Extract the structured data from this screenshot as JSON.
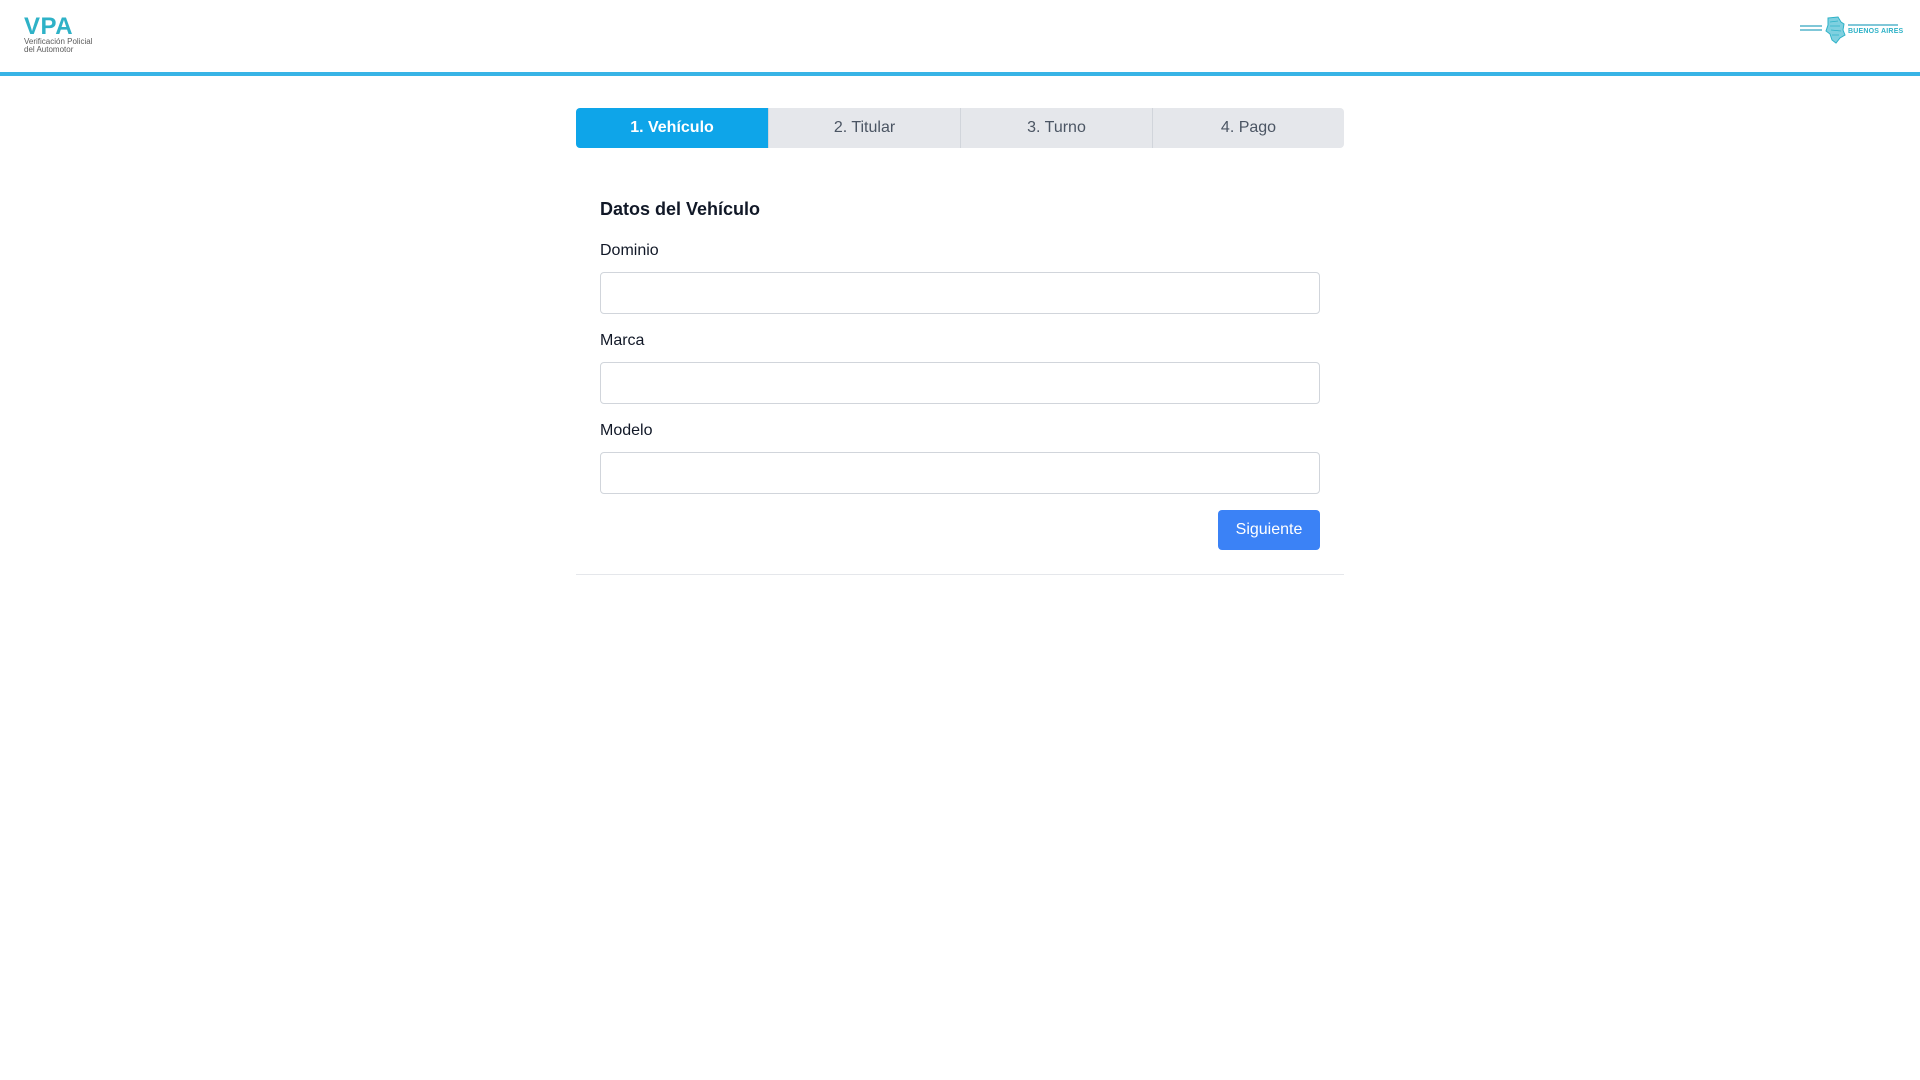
{
  "header": {
    "logo_left": {
      "title": "VPA",
      "subtitle_line1": "Verificación Policial",
      "subtitle_line2": "del Automotor"
    },
    "logo_right": {
      "name": "BUENOS AIRES"
    }
  },
  "steps": [
    {
      "label": "1. Vehículo",
      "active": true
    },
    {
      "label": "2. Titular",
      "active": false
    },
    {
      "label": "3. Turno",
      "active": false
    },
    {
      "label": "4. Pago",
      "active": false
    }
  ],
  "form": {
    "title": "Datos del Vehículo",
    "fields": [
      {
        "label": "Dominio",
        "value": "",
        "placeholder": ""
      },
      {
        "label": "Marca",
        "value": "",
        "placeholder": ""
      },
      {
        "label": "Modelo",
        "value": "",
        "placeholder": ""
      }
    ],
    "next_label": "Siguiente"
  },
  "colors": {
    "accent": "#38b4e6",
    "active_step": "#0ea5e9",
    "button": "#3b82f6"
  }
}
